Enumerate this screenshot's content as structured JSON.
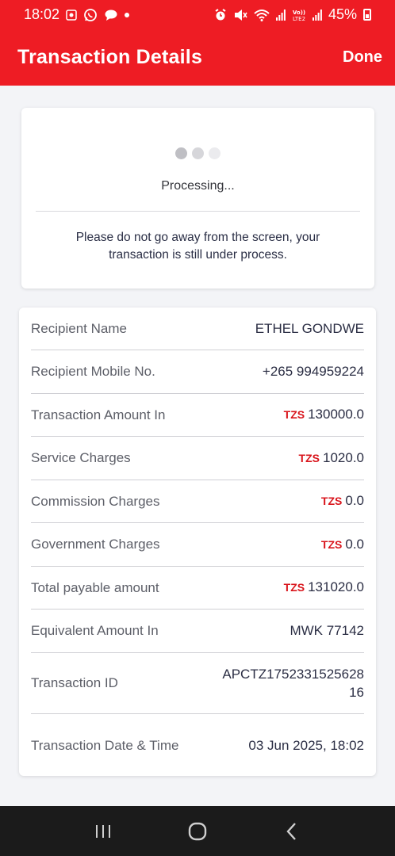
{
  "status_bar": {
    "time": "18:02",
    "battery_percent": "45%",
    "lte_label": "Vo))\nLTE2",
    "left_icons": [
      "carrier-app-icon",
      "whatsapp-icon",
      "chat-bubble-icon",
      "notification-dot"
    ],
    "right_icons": [
      "alarm-icon",
      "mute-icon",
      "wifi-icon",
      "signal-icon",
      "volte-icon",
      "signal-icon",
      "battery-icon"
    ]
  },
  "app_bar": {
    "title": "Transaction Details",
    "done_label": "Done"
  },
  "processing": {
    "status_text": "Processing...",
    "message": "Please do not go away from the screen, your transaction is still under process."
  },
  "details": {
    "rows": [
      {
        "label": "Recipient Name",
        "value": "ETHEL GONDWE",
        "currency": ""
      },
      {
        "label": "Recipient Mobile No.",
        "value": "+265 994959224",
        "currency": ""
      },
      {
        "label": "Transaction Amount In",
        "value": "130000.0",
        "currency": "TZS"
      },
      {
        "label": "Service Charges",
        "value": "1020.0",
        "currency": "TZS"
      },
      {
        "label": "Commission Charges",
        "value": "0.0",
        "currency": "TZS"
      },
      {
        "label": "Government Charges",
        "value": "0.0",
        "currency": "TZS"
      },
      {
        "label": "Total payable amount",
        "value": "131020.0",
        "currency": "TZS"
      },
      {
        "label": "Equivalent Amount In",
        "value": "MWK 77142",
        "currency": ""
      },
      {
        "label": "Transaction ID",
        "value": "APCTZ1752331525628\n16",
        "currency": ""
      },
      {
        "label": "Transaction Date & Time",
        "value": "03 Jun 2025, 18:02",
        "currency": ""
      }
    ]
  },
  "colors": {
    "brand_red": "#ee1c24",
    "currency_red": "#d9151c",
    "nav_bg": "#1b1b1b"
  },
  "nav_bar": {
    "icons": [
      "recent-apps-icon",
      "home-icon",
      "back-icon"
    ]
  }
}
